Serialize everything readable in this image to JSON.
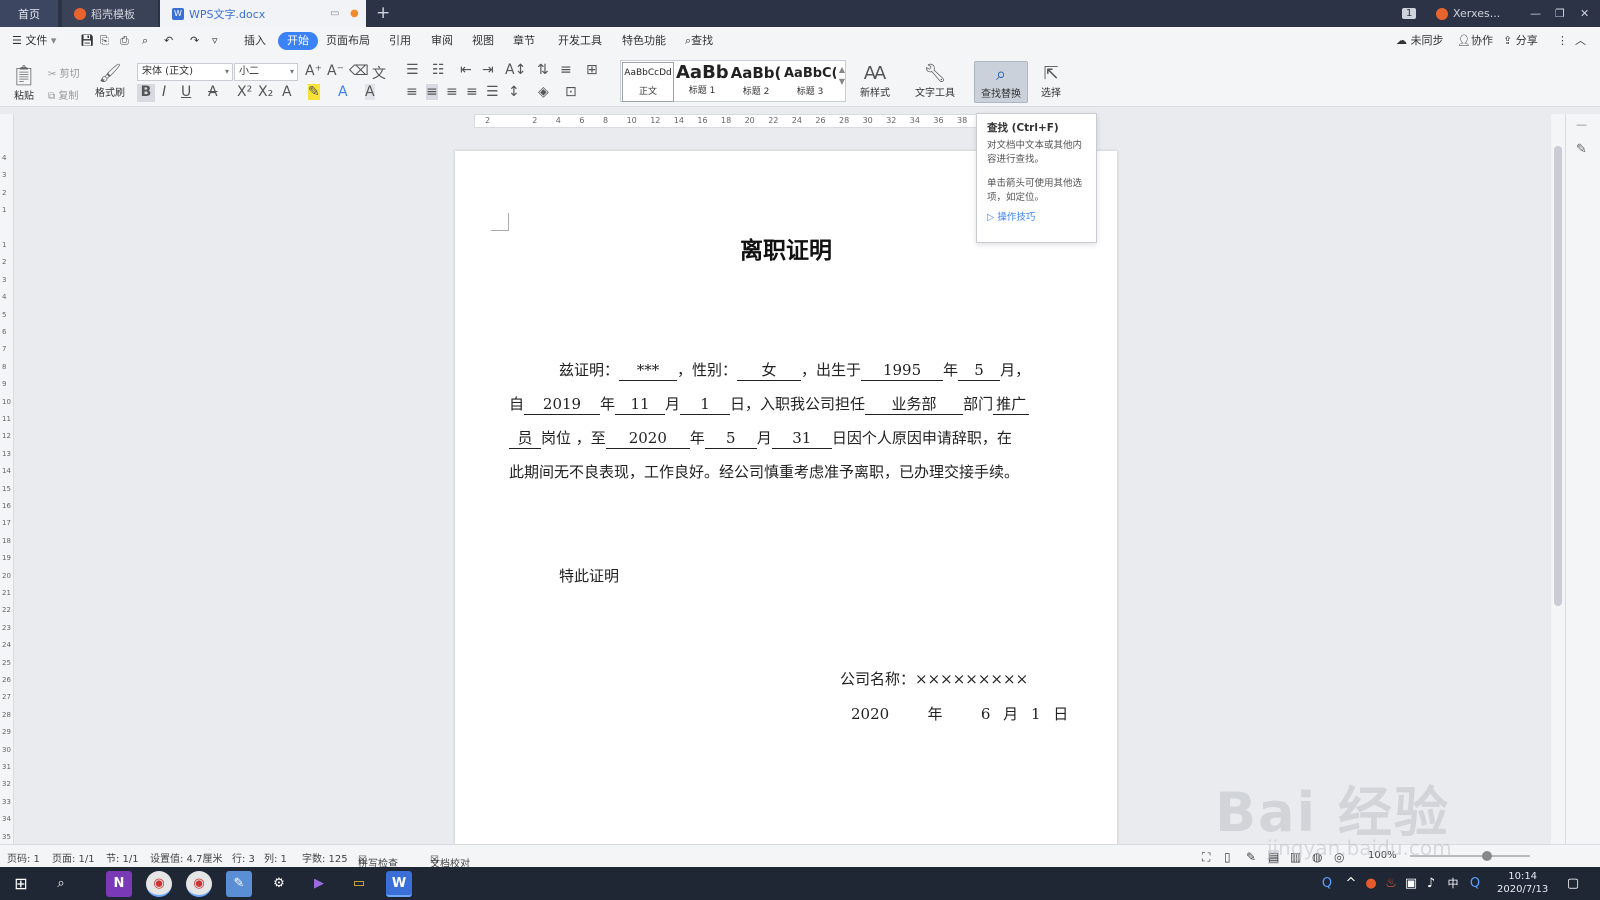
{
  "titlebar": {
    "tabs": [
      {
        "label": "首页"
      },
      {
        "label": "稻壳模板"
      },
      {
        "label": "WPS文字.docx"
      }
    ],
    "user": "Xerxes...",
    "window_badge": "1"
  },
  "menubar": {
    "file": "文件",
    "items": [
      "插入",
      "开始",
      "页面布局",
      "引用",
      "审阅",
      "视图",
      "章节",
      "开发工具",
      "特色功能",
      "查找"
    ],
    "right": [
      "未同步",
      "协作",
      "分享"
    ]
  },
  "ribbon": {
    "paste": "粘贴",
    "cut": "剪切",
    "copy": "复制",
    "format_painter": "格式刷",
    "font_name": "宋体 (正文)",
    "font_size": "小二",
    "styles": [
      {
        "sample": "AaBbCcDd",
        "name": "正文"
      },
      {
        "sample": "AaBb",
        "name": "标题 1"
      },
      {
        "sample": "AaBb(",
        "name": "标题 2"
      },
      {
        "sample": "AaBbC(",
        "name": "标题 3"
      }
    ],
    "new_style": "新样式",
    "text_tools": "文字工具",
    "find_replace": "查找替换",
    "select": "选择"
  },
  "tooltip": {
    "title": "查找 (Ctrl+F)",
    "line1": "对文档中文本或其他内容进行查找。",
    "line2": "单击箭头可使用其他选项，如定位。",
    "link": "操作技巧"
  },
  "ruler": {
    "h_ticks": [
      "2",
      "",
      "2",
      "4",
      "6",
      "8",
      "10",
      "12",
      "14",
      "16",
      "18",
      "20",
      "22",
      "24",
      "26",
      "28",
      "30",
      "32",
      "34",
      "36",
      "38"
    ],
    "v_ticks": [
      "4",
      "3",
      "2",
      "1",
      "",
      "1",
      "2",
      "3",
      "4",
      "5",
      "6",
      "7",
      "8",
      "9",
      "10",
      "11",
      "12",
      "13",
      "14",
      "15",
      "16",
      "17",
      "18",
      "19",
      "20",
      "21",
      "22",
      "23",
      "24",
      "25",
      "26",
      "27",
      "28",
      "29",
      "30",
      "31",
      "32",
      "33",
      "34",
      "35"
    ]
  },
  "document": {
    "title": "离职证明",
    "line1": {
      "p1": "兹证明：",
      "name": "***",
      "p2": "，性别：",
      "gender": "女",
      "p3": "，出生于",
      "birth_year": "1995",
      "p4": "年",
      "birth_month": "5",
      "p5": "月，"
    },
    "line2": {
      "p1": "自",
      "start_year": "2019",
      "p2": "年",
      "start_month": "11",
      "p3": "月",
      "start_day": "1",
      "p4": "日，入职我公司担任",
      "department": "业务部",
      "p5": "部门",
      "position_part1": "推广"
    },
    "line3": {
      "position_part2": "员",
      "p1": "岗位 ，至",
      "end_year": "2020",
      "p2": "年",
      "end_month": "5",
      "p3": "月",
      "end_day": "31",
      "p4": "日因个人原因申请辞职，在"
    },
    "line4": "此期间无不良表现，工作良好。经公司慎重考虑准予离职，已办理交接手续。",
    "closing": "特此证明",
    "company_label": "公司名称：",
    "company_value": "×××××××××",
    "date_line": {
      "year": "2020",
      "year_unit": "年",
      "month": "6",
      "month_unit": "月",
      "day": "1",
      "day_unit": "日"
    }
  },
  "statusbar": {
    "page_num": "页码: 1",
    "pages": "页面: 1/1",
    "section": "节: 1/1",
    "setting": "设置值: 4.7厘米",
    "row": "行: 3",
    "col": "列: 1",
    "word_count": "字数: 125",
    "spell_check": "拼写检查",
    "doc_check": "文档校对",
    "zoom": "100%"
  },
  "taskbar": {
    "time": "10:14",
    "date": "2020/7/13",
    "ime": "中"
  },
  "watermark": {
    "text": "Bai 经验",
    "sub": "jingyan.baidu.com"
  },
  "colors": {
    "accent": "#3b82f6",
    "titlebar_bg": "#2c3347",
    "taskbar_bg": "#1f2735"
  }
}
